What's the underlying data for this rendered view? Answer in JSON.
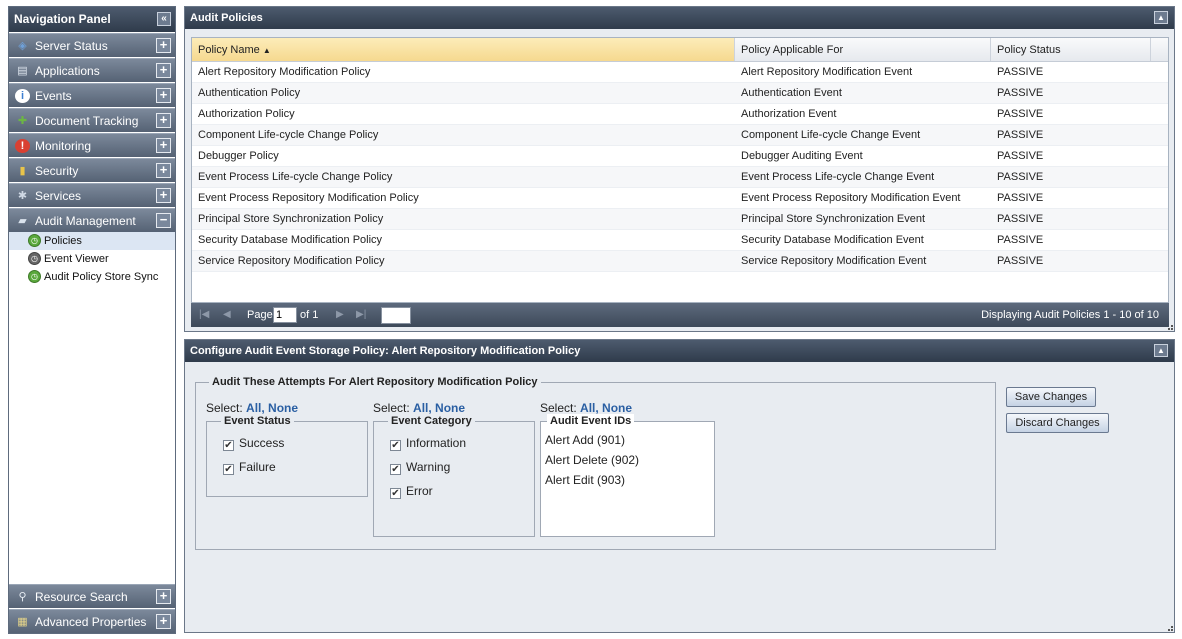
{
  "nav": {
    "title": "Navigation Panel",
    "collapse_icon": "double-chevron-left-icon",
    "items": [
      {
        "label": "Server Status",
        "icon": "server-icon",
        "toggle": "+"
      },
      {
        "label": "Applications",
        "icon": "applications-icon",
        "toggle": "+"
      },
      {
        "label": "Events",
        "icon": "info-icon",
        "toggle": "+"
      },
      {
        "label": "Document Tracking",
        "icon": "puzzle-icon",
        "toggle": "+"
      },
      {
        "label": "Monitoring",
        "icon": "alert-icon",
        "toggle": "+"
      },
      {
        "label": "Security",
        "icon": "lock-icon",
        "toggle": "+"
      },
      {
        "label": "Services",
        "icon": "services-icon",
        "toggle": "+"
      },
      {
        "label": "Audit Management",
        "icon": "chat-icon",
        "toggle": "−"
      }
    ],
    "sub_items": [
      {
        "label": "Policies",
        "icon": "clock-icon"
      },
      {
        "label": "Event Viewer",
        "icon": "clock-icon"
      },
      {
        "label": "Audit Policy Store Sync",
        "icon": "clock-icon"
      }
    ],
    "bottom_items": [
      {
        "label": "Resource Search",
        "icon": "search-icon",
        "toggle": "+"
      },
      {
        "label": "Advanced Properties",
        "icon": "properties-icon",
        "toggle": "+"
      }
    ]
  },
  "policies_panel": {
    "title": "Audit Policies",
    "columns": [
      "Policy Name",
      "Policy Applicable For",
      "Policy Status"
    ],
    "sort_indicator": "▲",
    "rows": [
      [
        "Alert Repository Modification Policy",
        "Alert Repository Modification Event",
        "PASSIVE"
      ],
      [
        "Authentication Policy",
        "Authentication Event",
        "PASSIVE"
      ],
      [
        "Authorization Policy",
        "Authorization Event",
        "PASSIVE"
      ],
      [
        "Component Life-cycle Change Policy",
        "Component Life-cycle Change Event",
        "PASSIVE"
      ],
      [
        "Debugger Policy",
        "Debugger Auditing Event",
        "PASSIVE"
      ],
      [
        "Event Process Life-cycle Change Policy",
        "Event Process Life-cycle Change Event",
        "PASSIVE"
      ],
      [
        "Event Process Repository Modification Policy",
        "Event Process Repository Modification Event",
        "PASSIVE"
      ],
      [
        "Principal Store Synchronization Policy",
        "Principal Store Synchronization Event",
        "PASSIVE"
      ],
      [
        "Security Database Modification Policy",
        "Security Database Modification Event",
        "PASSIVE"
      ],
      [
        "Service Repository Modification Policy",
        "Service Repository Modification Event",
        "PASSIVE"
      ]
    ],
    "pager": {
      "page_label": "Page",
      "page_value": "1",
      "of_label": "of 1",
      "status": "Displaying Audit Policies 1 - 10 of 10"
    }
  },
  "config_panel": {
    "title": "Configure Audit Event Storage Policy: Alert Repository Modification Policy",
    "group_title": "Audit These Attempts For Alert Repository Modification Policy",
    "select_label": "Select:",
    "all_label": "All,",
    "none_label": "None",
    "event_status": {
      "title": "Event Status",
      "options": [
        {
          "label": "Success",
          "checked": true
        },
        {
          "label": "Failure",
          "checked": true
        }
      ]
    },
    "event_category": {
      "title": "Event Category",
      "options": [
        {
          "label": "Information",
          "checked": true
        },
        {
          "label": "Warning",
          "checked": true
        },
        {
          "label": "Error",
          "checked": true
        }
      ]
    },
    "event_ids": {
      "title": "Audit Event IDs",
      "items": [
        "Alert Add (901)",
        "Alert Delete (902)",
        "Alert Edit (903)"
      ]
    },
    "save_label": "Save Changes",
    "discard_label": "Discard Changes"
  }
}
